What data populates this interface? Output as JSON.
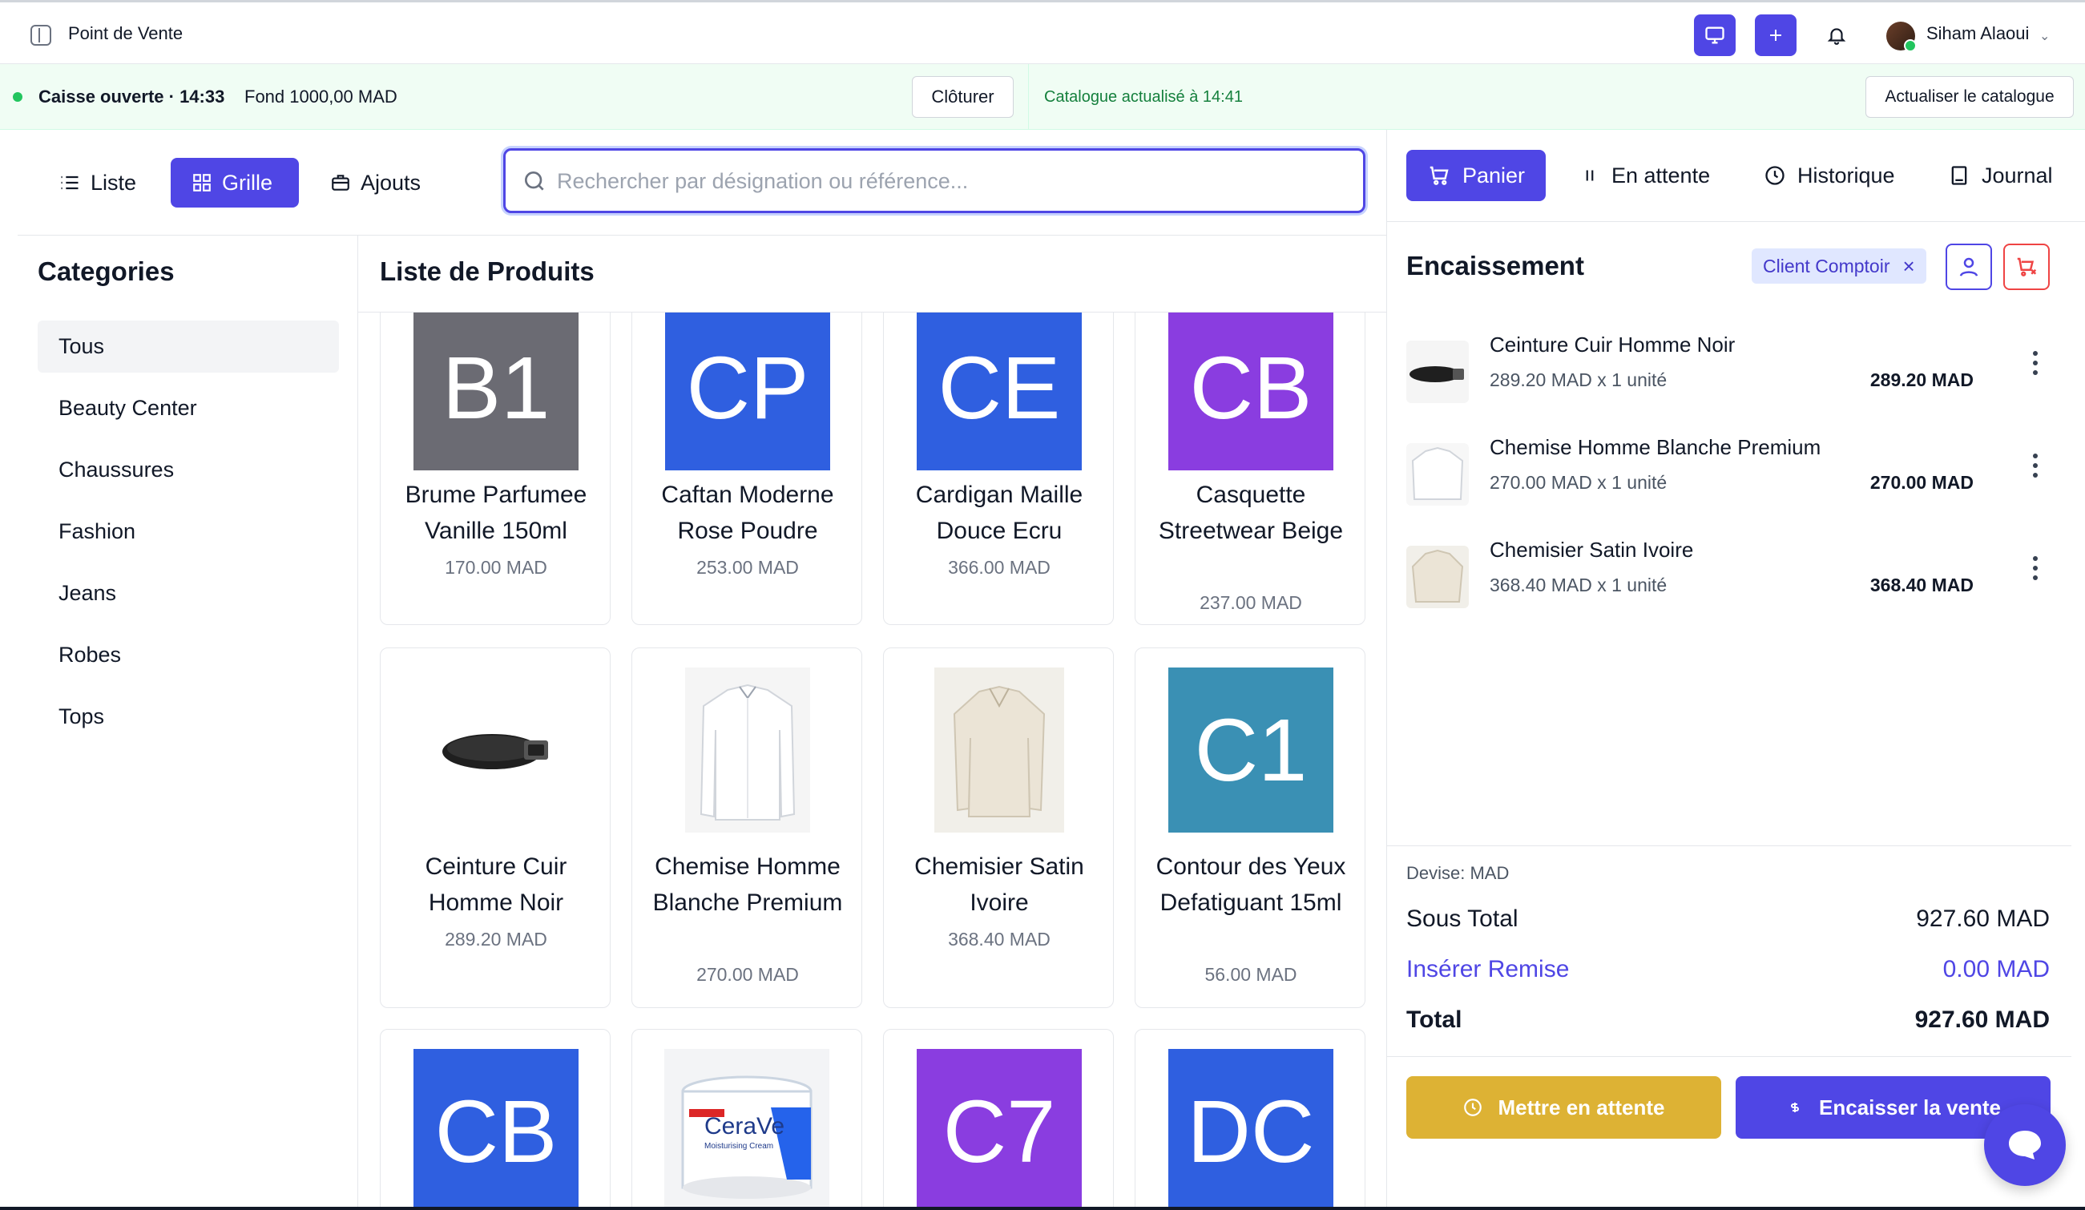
{
  "header": {
    "title": "Point de Vente",
    "user_name": "Siham Alaoui",
    "icons": [
      "sidebar-toggle-icon",
      "monitor-icon",
      "plus-icon",
      "bell-icon",
      "chevron-down-icon"
    ]
  },
  "status": {
    "register_open": "Caisse ouverte · 14:33",
    "fund": "Fond 1000,00 MAD",
    "close_label": "Clôturer",
    "catalog_updated": "Catalogue actualisé à 14:41",
    "refresh_label": "Actualiser le catalogue",
    "accent_color": "#22c55e"
  },
  "toolbar": {
    "list_label": "Liste",
    "grid_label": "Grille",
    "addons_label": "Ajouts",
    "search_placeholder": "Rechercher par désignation ou référence..."
  },
  "categories": {
    "title": "Categories",
    "items": [
      "Tous",
      "Beauty Center",
      "Chaussures",
      "Fashion",
      "Jeans",
      "Robes",
      "Tops"
    ],
    "selected": "Tous"
  },
  "products": {
    "title": "Liste de Produits",
    "items": [
      {
        "code": "B1",
        "name": "Brume Parfumee Vanille 150ml",
        "price": "170.00 MAD",
        "color": "#6b6b73"
      },
      {
        "code": "CP",
        "name": "Caftan Moderne Rose Poudre",
        "price": "253.00 MAD",
        "color": "#2f5fe0"
      },
      {
        "code": "CE",
        "name": "Cardigan Maille Douce Ecru",
        "price": "366.00 MAD",
        "color": "#2f5fe0"
      },
      {
        "code": "CB",
        "name": "Casquette Streetwear Beige",
        "price": "237.00 MAD",
        "color": "#8a3de0"
      },
      {
        "code": "",
        "name": "Ceinture Cuir Homme Noir",
        "price": "289.20 MAD",
        "image": "belt"
      },
      {
        "code": "",
        "name": "Chemise Homme Blanche Premium",
        "price": "270.00 MAD",
        "image": "shirt"
      },
      {
        "code": "",
        "name": "Chemisier Satin Ivoire",
        "price": "368.40 MAD",
        "image": "blouse"
      },
      {
        "code": "C1",
        "name": "Contour des Yeux Defatiguant 15ml",
        "price": "56.00 MAD",
        "color": "#3a90b4"
      },
      {
        "code": "CB",
        "name": "",
        "price": "",
        "color": "#2f5fe0"
      },
      {
        "code": "",
        "name": "",
        "price": "",
        "image": "cream",
        "brand": "CeraVe",
        "subtitle": "Moisturising Cream"
      },
      {
        "code": "C7",
        "name": "",
        "price": "",
        "color": "#8a3de0"
      },
      {
        "code": "DC",
        "name": "",
        "price": "",
        "color": "#2f5fe0"
      }
    ]
  },
  "right_tabs": [
    "Panier",
    "En attente",
    "Historique",
    "Journal"
  ],
  "checkout": {
    "title": "Encaissement",
    "client": "Client Comptoir",
    "cart": [
      {
        "name": "Ceinture Cuir Homme Noir",
        "qty": "289.20 MAD x 1 unité",
        "total": "289.20 MAD",
        "image": "belt"
      },
      {
        "name": "Chemise Homme Blanche Premium",
        "qty": "270.00 MAD x 1 unité",
        "total": "270.00 MAD",
        "image": "shirt"
      },
      {
        "name": "Chemisier Satin Ivoire",
        "qty": "368.40 MAD x 1 unité",
        "total": "368.40 MAD",
        "image": "blouse"
      }
    ],
    "currency": "Devise: MAD",
    "subtotal_label": "Sous Total",
    "subtotal": "927.60 MAD",
    "discount_label": "Insérer Remise",
    "discount": "0.00 MAD",
    "total_label": "Total",
    "total": "927.60 MAD",
    "hold_label": "Mettre en attente",
    "pay_label": "Encaisser la vente",
    "hold_color": "#ddb234",
    "brand_color": "#4f46e5"
  }
}
